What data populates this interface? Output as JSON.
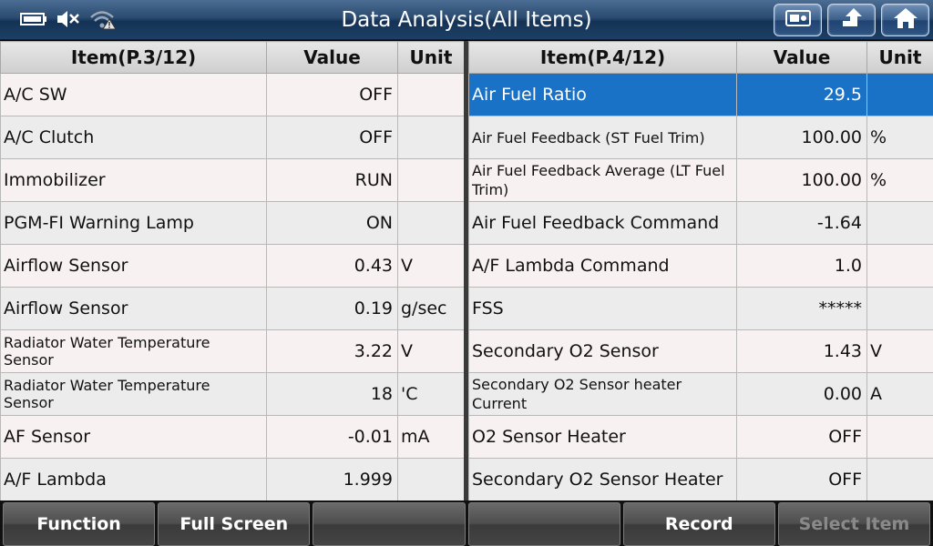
{
  "header": {
    "title": "Data Analysis(All Items)",
    "status_icons": [
      "battery-icon",
      "mute-icon",
      "wifi-warning-icon"
    ],
    "buttons": [
      "snapshot-icon",
      "back-icon",
      "home-icon"
    ]
  },
  "left_table": {
    "headers": {
      "item": "Item(P.3/12)",
      "value": "Value",
      "unit": "Unit"
    },
    "rows": [
      {
        "name": "A/C SW",
        "value": "OFF",
        "unit": ""
      },
      {
        "name": "A/C Clutch",
        "value": "OFF",
        "unit": ""
      },
      {
        "name": "Immobilizer",
        "value": "RUN",
        "unit": ""
      },
      {
        "name": "PGM-FI Warning Lamp",
        "value": "ON",
        "unit": ""
      },
      {
        "name": "Airflow Sensor",
        "value": "0.43",
        "unit": "V"
      },
      {
        "name": "Airflow Sensor",
        "value": "0.19",
        "unit": "g/sec"
      },
      {
        "name": "Radiator Water Temperature Sensor",
        "value": "3.22",
        "unit": "V"
      },
      {
        "name": "Radiator Water Temperature Sensor",
        "value": "18",
        "unit": "'C"
      },
      {
        "name": "AF Sensor",
        "value": "-0.01",
        "unit": "mA"
      },
      {
        "name": "A/F Lambda",
        "value": "1.999",
        "unit": ""
      }
    ]
  },
  "right_table": {
    "headers": {
      "item": "Item(P.4/12)",
      "value": "Value",
      "unit": "Unit"
    },
    "rows": [
      {
        "name": "Air Fuel Ratio",
        "value": "29.5",
        "unit": ""
      },
      {
        "name": "Air Fuel Feedback (ST Fuel Trim)",
        "value": "100.00",
        "unit": "%"
      },
      {
        "name": "Air Fuel Feedback Average (LT Fuel Trim)",
        "value": "100.00",
        "unit": "%"
      },
      {
        "name": "Air Fuel Feedback Command",
        "value": "-1.64",
        "unit": ""
      },
      {
        "name": "A/F Lambda Command",
        "value": "1.0",
        "unit": ""
      },
      {
        "name": "FSS",
        "value": "*****",
        "unit": ""
      },
      {
        "name": "Secondary O2 Sensor",
        "value": "1.43",
        "unit": "V"
      },
      {
        "name": "Secondary O2 Sensor heater Current",
        "value": "0.00",
        "unit": "A"
      },
      {
        "name": "O2 Sensor Heater",
        "value": "OFF",
        "unit": ""
      },
      {
        "name": "Secondary O2 Sensor Heater",
        "value": "OFF",
        "unit": ""
      }
    ]
  },
  "footer": {
    "buttons": [
      {
        "label": "Function",
        "enabled": true
      },
      {
        "label": "Full Screen",
        "enabled": true
      },
      {
        "label": "",
        "enabled": true
      },
      {
        "label": "",
        "enabled": true
      },
      {
        "label": "Record",
        "enabled": true
      },
      {
        "label": "Select Item",
        "enabled": false
      }
    ]
  },
  "colors": {
    "selected_row": "#1a72c7",
    "header_bar": "#1d3f66"
  }
}
